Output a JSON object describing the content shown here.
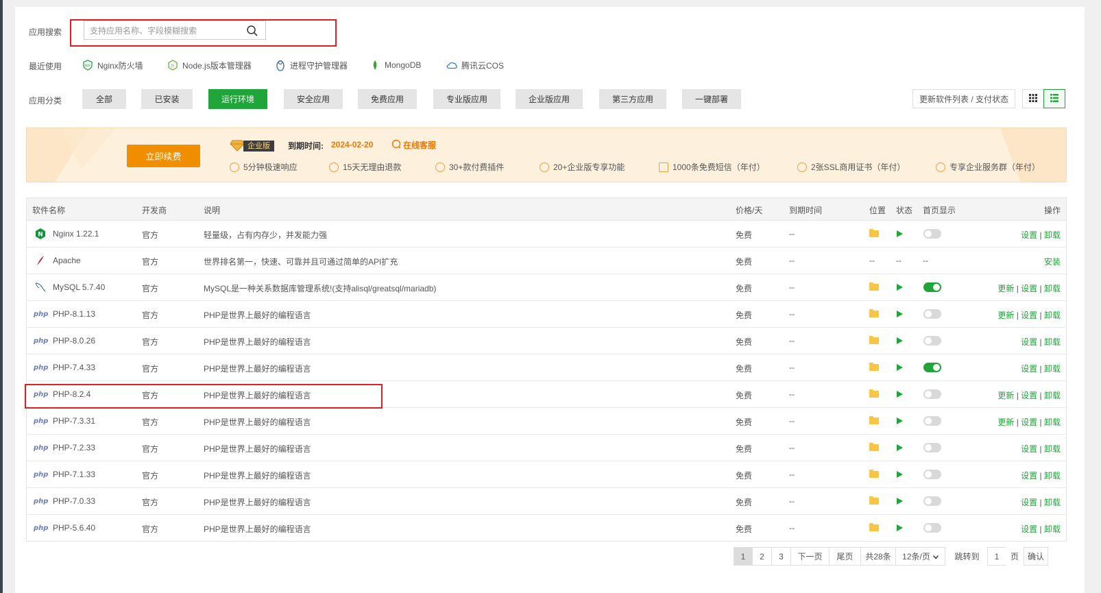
{
  "search": {
    "label": "应用搜索",
    "placeholder": "支持应用名称、字段模糊搜索"
  },
  "recent": {
    "label": "最近使用",
    "items": [
      {
        "label": "Nginx防火墙",
        "icon": "waf-icon"
      },
      {
        "label": "Node.js版本管理器",
        "icon": "nodejs-icon"
      },
      {
        "label": "进程守护管理器",
        "icon": "penguin-icon"
      },
      {
        "label": "MongoDB",
        "icon": "mongodb-leaf-icon"
      },
      {
        "label": "腾讯云COS",
        "icon": "cloud-icon"
      }
    ]
  },
  "categories": {
    "label": "应用分类",
    "items": [
      "全部",
      "已安装",
      "运行环境",
      "安全应用",
      "免费应用",
      "专业版应用",
      "企业版应用",
      "第三方应用",
      "一键部署"
    ],
    "active": "运行环境"
  },
  "toolbar": {
    "update_label": "更新软件列表 / 支付状态"
  },
  "banner": {
    "renew_label": "立即续费",
    "edition": "企业版",
    "expiry_label": "到期时间:",
    "expiry_date": "2024-02-20",
    "service_label": "在线客服",
    "features": [
      "5分钟极速响应",
      "15天无理由退款",
      "30+款付费插件",
      "20+企业版专享功能",
      "1000条免费短信（年付）",
      "2张SSL商用证书（年付）",
      "专享企业服务群（年付）"
    ]
  },
  "table": {
    "headers": {
      "name": "软件名称",
      "dev": "开发商",
      "desc": "说明",
      "price": "价格/天",
      "expire": "到期时间",
      "loc": "位置",
      "status": "状态",
      "home": "首页显示",
      "ops": "操作"
    },
    "rows": [
      {
        "name": "Nginx 1.22.1",
        "icon": "nginx-icon",
        "dev": "官方",
        "desc": "轻量级，占有内存少，并发能力强",
        "price": "免费",
        "expire": "--",
        "installed": true,
        "home": false,
        "ops": [
          "设置",
          "卸载"
        ]
      },
      {
        "name": "Apache",
        "icon": "apache-feather-icon",
        "dev": "官方",
        "desc": "世界排名第一，快速、可靠并且可通过简单的API扩充",
        "price": "免费",
        "expire": "--",
        "installed": false,
        "placeholder": "--",
        "ops": [
          "安装"
        ]
      },
      {
        "name": "MySQL 5.7.40",
        "icon": "mysql-dolphin-icon",
        "dev": "官方",
        "desc": "MySQL是一种关系数据库管理系统!(支持alisql/greatsql/mariadb)",
        "price": "免费",
        "expire": "--",
        "installed": true,
        "home": true,
        "ops": [
          "更新",
          "设置",
          "卸载"
        ]
      },
      {
        "name": "PHP-8.1.13",
        "icon": "php-icon",
        "dev": "官方",
        "desc": "PHP是世界上最好的编程语言",
        "price": "免费",
        "expire": "--",
        "installed": true,
        "home": false,
        "ops": [
          "更新",
          "设置",
          "卸载"
        ]
      },
      {
        "name": "PHP-8.0.26",
        "icon": "php-icon",
        "dev": "官方",
        "desc": "PHP是世界上最好的编程语言",
        "price": "免费",
        "expire": "--",
        "installed": true,
        "home": false,
        "ops": [
          "设置",
          "卸载"
        ]
      },
      {
        "name": "PHP-7.4.33",
        "icon": "php-icon",
        "dev": "官方",
        "desc": "PHP是世界上最好的编程语言",
        "price": "免费",
        "expire": "--",
        "installed": true,
        "home": true,
        "ops": [
          "设置",
          "卸载"
        ]
      },
      {
        "name": "PHP-8.2.4",
        "icon": "php-icon",
        "dev": "官方",
        "desc": "PHP是世界上最好的编程语言",
        "price": "免费",
        "expire": "--",
        "installed": true,
        "home": false,
        "ops": [
          "更新",
          "设置",
          "卸载"
        ]
      },
      {
        "name": "PHP-7.3.31",
        "icon": "php-icon",
        "dev": "官方",
        "desc": "PHP是世界上最好的编程语言",
        "price": "免费",
        "expire": "--",
        "installed": true,
        "home": false,
        "ops": [
          "更新",
          "设置",
          "卸载"
        ]
      },
      {
        "name": "PHP-7.2.33",
        "icon": "php-icon",
        "dev": "官方",
        "desc": "PHP是世界上最好的编程语言",
        "price": "免费",
        "expire": "--",
        "installed": true,
        "home": false,
        "ops": [
          "设置",
          "卸载"
        ]
      },
      {
        "name": "PHP-7.1.33",
        "icon": "php-icon",
        "dev": "官方",
        "desc": "PHP是世界上最好的编程语言",
        "price": "免费",
        "expire": "--",
        "installed": true,
        "home": false,
        "ops": [
          "设置",
          "卸载"
        ]
      },
      {
        "name": "PHP-7.0.33",
        "icon": "php-icon",
        "dev": "官方",
        "desc": "PHP是世界上最好的编程语言",
        "price": "免费",
        "expire": "--",
        "installed": true,
        "home": false,
        "ops": [
          "设置",
          "卸载"
        ]
      },
      {
        "name": "PHP-5.6.40",
        "icon": "php-icon",
        "dev": "官方",
        "desc": "PHP是世界上最好的编程语言",
        "price": "免费",
        "expire": "--",
        "installed": true,
        "home": false,
        "ops": [
          "设置",
          "卸载"
        ]
      }
    ]
  },
  "pagination": {
    "pages": [
      "1",
      "2",
      "3"
    ],
    "current": "1",
    "next": "下一页",
    "last": "尾页",
    "total": "共28条",
    "per_page": "12条/页",
    "jump_label": "跳转到",
    "jump_value": "1",
    "page_unit": "页",
    "confirm": "确认"
  },
  "colors": {
    "accent": "#20a53a",
    "orange": "#f08e00",
    "highlight": "#e02020"
  }
}
